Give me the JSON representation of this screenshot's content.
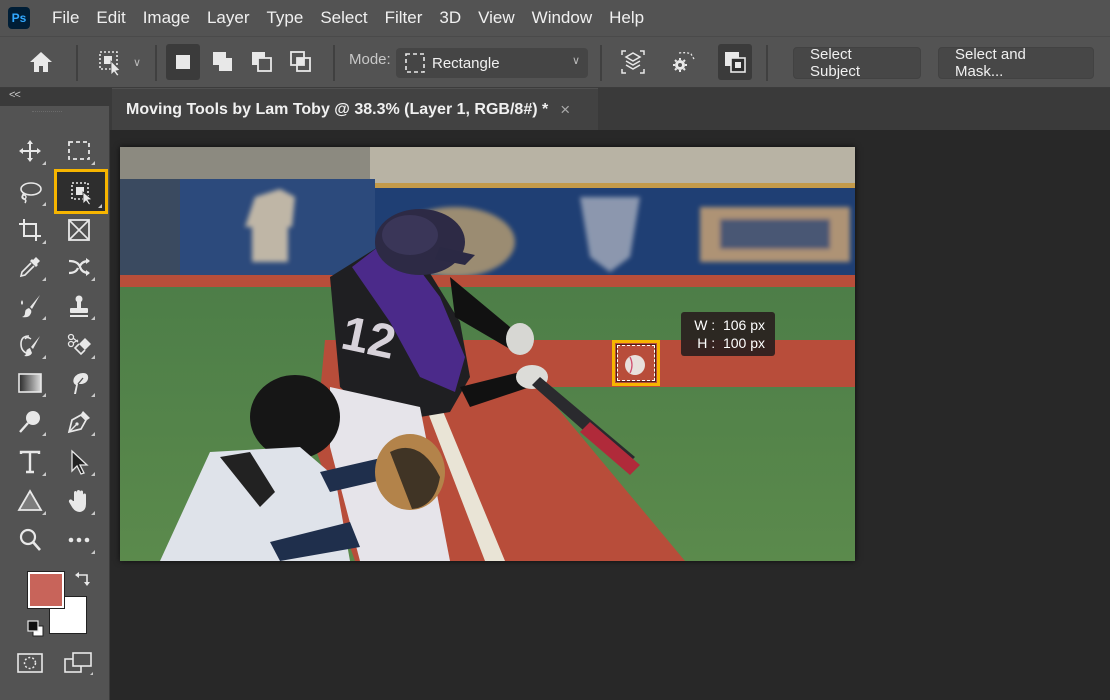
{
  "app": {
    "logo": "Ps",
    "menu": [
      "File",
      "Edit",
      "Image",
      "Layer",
      "Type",
      "Select",
      "Filter",
      "3D",
      "View",
      "Window",
      "Help"
    ]
  },
  "options_bar": {
    "home_icon": "home-icon",
    "tool_preset_icon": "object-selection-icon",
    "selection_modes": [
      "new-selection",
      "add-to-selection",
      "subtract-from-selection",
      "intersect-with-selection"
    ],
    "active_selection_mode": "new-selection",
    "mode_label": "Mode:",
    "mode_value": "Rectangle",
    "sample_all_layers_icon": "sample-all-layers-icon",
    "object_subtract_icon": "object-subtract-icon",
    "hard_edge_icon": "hard-edge-icon",
    "select_subject_label": "Select Subject",
    "select_and_mask_label": "Select and Mask..."
  },
  "toolbar": {
    "collapse_label": "<<",
    "tools": [
      {
        "name": "move-tool",
        "selected": false
      },
      {
        "name": "rectangular-marquee-tool",
        "selected": false
      },
      {
        "name": "lasso-tool",
        "selected": false
      },
      {
        "name": "object-selection-tool",
        "selected": true
      },
      {
        "name": "crop-tool",
        "selected": false
      },
      {
        "name": "frame-tool",
        "selected": false
      },
      {
        "name": "eyedropper-tool",
        "selected": false
      },
      {
        "name": "content-aware-move-tool",
        "selected": false
      },
      {
        "name": "brush-tool",
        "selected": false
      },
      {
        "name": "clone-stamp-tool",
        "selected": false
      },
      {
        "name": "history-brush-tool",
        "selected": false
      },
      {
        "name": "eraser-tool",
        "selected": false
      },
      {
        "name": "gradient-tool",
        "selected": false
      },
      {
        "name": "smudge-tool",
        "selected": false
      },
      {
        "name": "dodge-tool",
        "selected": false
      },
      {
        "name": "pen-tool",
        "selected": false
      },
      {
        "name": "type-tool",
        "selected": false
      },
      {
        "name": "path-selection-tool",
        "selected": false
      },
      {
        "name": "shape-tool",
        "selected": false
      },
      {
        "name": "hand-tool",
        "selected": false
      },
      {
        "name": "zoom-tool",
        "selected": false
      },
      {
        "name": "edit-toolbar",
        "selected": false
      }
    ],
    "foreground_color": "#c8645a",
    "background_color": "#ffffff"
  },
  "document": {
    "tab_title": "Moving Tools by Lam Toby @ 38.3% (Layer 1, RGB/8#) *",
    "close_label": "×"
  },
  "canvas": {
    "image_description": "Baseball batter in purple jersey #12 swinging at a ball, catcher crouched in front",
    "jersey_number": "12",
    "selection_tooltip": {
      "width_line": "W :  106 px",
      "height_line": "H :  100 px"
    },
    "highlight_color": "#f7b500"
  }
}
